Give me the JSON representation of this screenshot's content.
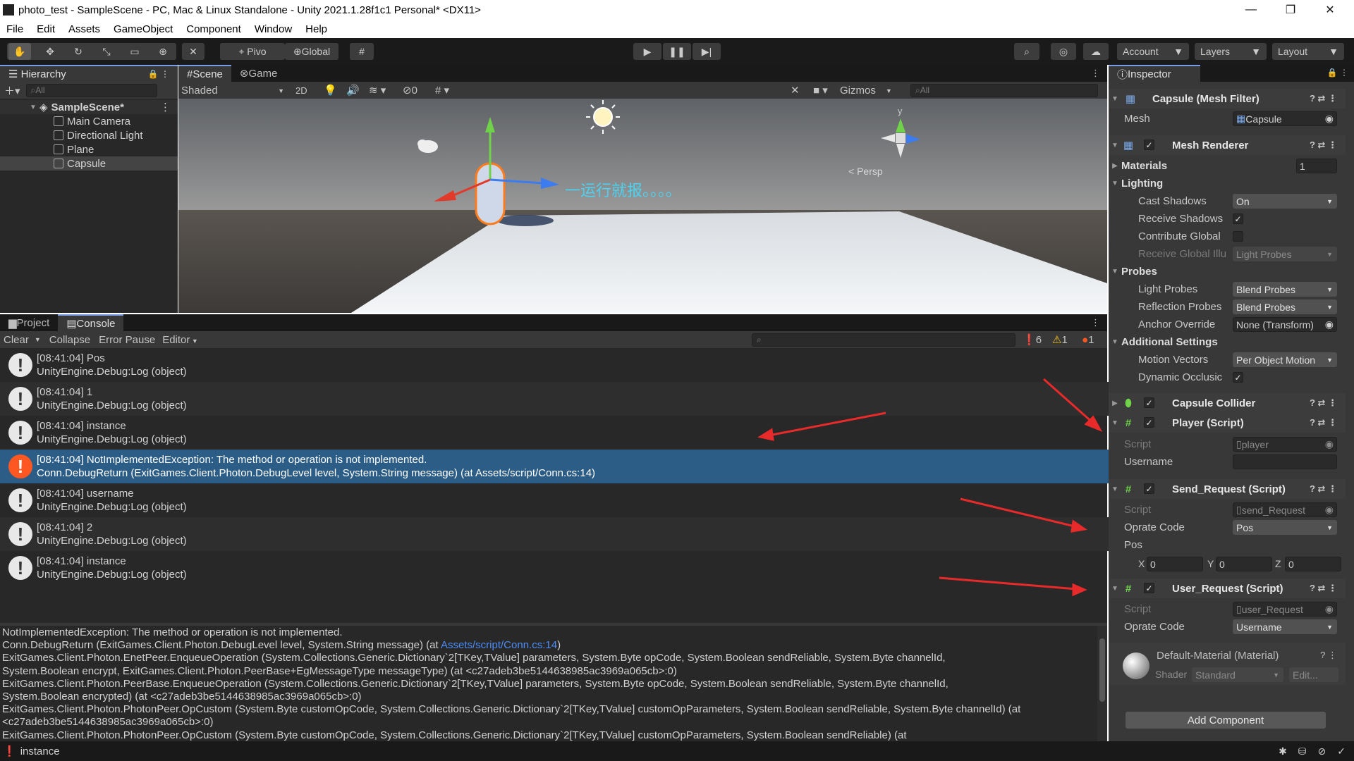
{
  "window": {
    "title": "photo_test - SampleScene - PC, Mac & Linux Standalone - Unity 2021.1.28f1c1 Personal* <DX11>",
    "minimize": "—",
    "restore": "❐",
    "close": "✕"
  },
  "menu": [
    "File",
    "Edit",
    "Assets",
    "GameObject",
    "Component",
    "Window",
    "Help"
  ],
  "toolbar": {
    "pivot": "Pivo",
    "global": "Global",
    "account": "Account",
    "layers": "Layers",
    "layout": "Layout",
    "icons": [
      "hand-tool-icon",
      "move-tool-icon",
      "rotate-tool-icon",
      "scale-tool-icon",
      "rect-tool-icon",
      "transform-tool-icon",
      "custom-tool-icon"
    ]
  },
  "hierarchy": {
    "tab": "Hierarchy",
    "search": "All",
    "scene": "SampleScene*",
    "items": [
      "Main Camera",
      "Directional Light",
      "Plane",
      "Capsule"
    ]
  },
  "scene": {
    "tabs": [
      "Scene",
      "Game"
    ],
    "shading": "Shaded",
    "mode_2d": "2D",
    "hidden_count": "0",
    "gizmos": "Gizmos",
    "search": "All",
    "persp": "< Persp",
    "overlay_text": "一运行就报。。。。",
    "axis_y": "y"
  },
  "console": {
    "tabs": [
      "Project",
      "Console"
    ],
    "clear": "Clear",
    "collapse": "Collapse",
    "error_pause": "Error Pause",
    "editor": "Editor",
    "counts": {
      "log": "6",
      "warn": "1",
      "error": "1"
    },
    "rows": [
      {
        "line1": "[08:41:04] Pos",
        "line2": "UnityEngine.Debug:Log (object)",
        "type": "log"
      },
      {
        "line1": "[08:41:04] 1",
        "line2": "UnityEngine.Debug:Log (object)",
        "type": "log"
      },
      {
        "line1": "[08:41:04] instance",
        "line2": "UnityEngine.Debug:Log (object)",
        "type": "log"
      },
      {
        "line1": "[08:41:04] NotImplementedException: The method or operation is not implemented.",
        "line2": "Conn.DebugReturn (ExitGames.Client.Photon.DebugLevel level, System.String message) (at Assets/script/Conn.cs:14)",
        "type": "error"
      },
      {
        "line1": "[08:41:04] username",
        "line2": "UnityEngine.Debug:Log (object)",
        "type": "log"
      },
      {
        "line1": "[08:41:04] 2",
        "line2": "UnityEngine.Debug:Log (object)",
        "type": "log"
      },
      {
        "line1": "[08:41:04] instance",
        "line2": "UnityEngine.Debug:Log (object)",
        "type": "log"
      }
    ],
    "detail": {
      "l1": "NotImplementedException: The method or operation is not implemented.",
      "l2a": "Conn.DebugReturn (ExitGames.Client.Photon.DebugLevel level, System.String message) (at ",
      "l2link": "Assets/script/Conn.cs:14",
      "l2b": ")",
      "l3": "ExitGames.Client.Photon.EnetPeer.EnqueueOperation (System.Collections.Generic.Dictionary`2[TKey,TValue] parameters, System.Byte opCode, System.Boolean sendReliable, System.Byte channelId,",
      "l4": "System.Boolean encrypt, ExitGames.Client.Photon.PeerBase+EgMessageType messageType) (at <c27adeb3be5144638985ac3969a065cb>:0)",
      "l5": "ExitGames.Client.Photon.PeerBase.EnqueueOperation (System.Collections.Generic.Dictionary`2[TKey,TValue] parameters, System.Byte opCode, System.Boolean sendReliable, System.Byte channelId,",
      "l6": "System.Boolean encrypted) (at <c27adeb3be5144638985ac3969a065cb>:0)",
      "l7": "ExitGames.Client.Photon.PhotonPeer.OpCustom (System.Byte customOpCode, System.Collections.Generic.Dictionary`2[TKey,TValue] customOpParameters, System.Boolean sendReliable, System.Byte channelId) (at",
      "l8": "<c27adeb3be5144638985ac3969a065cb>:0)",
      "l9": "ExitGames.Client.Photon.PhotonPeer.OpCustom (System.Byte customOpCode, System.Collections.Generic.Dictionary`2[TKey,TValue] customOpParameters, System.Boolean sendReliable) (at"
    }
  },
  "statusbar": {
    "text": "instance"
  },
  "inspector": {
    "tab": "Inspector",
    "mesh_filter": {
      "title": "Capsule (Mesh Filter)",
      "mesh_label": "Mesh",
      "mesh_value": "Capsule"
    },
    "mesh_renderer": {
      "title": "Mesh Renderer",
      "materials_label": "Materials",
      "materials_count": "1",
      "lighting": "Lighting",
      "cast_shadows": "Cast Shadows",
      "cast_shadows_value": "On",
      "receive_shadows": "Receive Shadows",
      "contribute_global": "Contribute Global",
      "receive_global": "Receive Global Illu",
      "receive_global_value": "Light Probes",
      "probes": "Probes",
      "light_probes": "Light Probes",
      "light_probes_value": "Blend Probes",
      "reflection_probes": "Reflection Probes",
      "reflection_probes_value": "Blend Probes",
      "anchor_override": "Anchor Override",
      "anchor_override_value": "None (Transform)",
      "additional": "Additional Settings",
      "motion_vectors": "Motion Vectors",
      "motion_vectors_value": "Per Object Motion",
      "dynamic_occlusion": "Dynamic Occlusic"
    },
    "capsule_collider": {
      "title": "Capsule Collider"
    },
    "player": {
      "title": "Player (Script)",
      "script_label": "Script",
      "script_value": "player",
      "username_label": "Username"
    },
    "send_request": {
      "title": "Send_Request (Script)",
      "script_label": "Script",
      "script_value": "send_Request",
      "opcode_label": "Oprate Code",
      "opcode_value": "Pos",
      "pos_label": "Pos",
      "x": "X",
      "xv": "0",
      "y": "Y",
      "yv": "0",
      "z": "Z",
      "zv": "0"
    },
    "user_request": {
      "title": "User_Request (Script)",
      "script_label": "Script",
      "script_value": "user_Request",
      "opcode_label": "Oprate Code",
      "opcode_value": "Username"
    },
    "material": {
      "title": "Default-Material (Material)",
      "shader_label": "Shader",
      "shader_value": "Standard",
      "edit": "Edit..."
    },
    "add_component": "Add Component"
  }
}
